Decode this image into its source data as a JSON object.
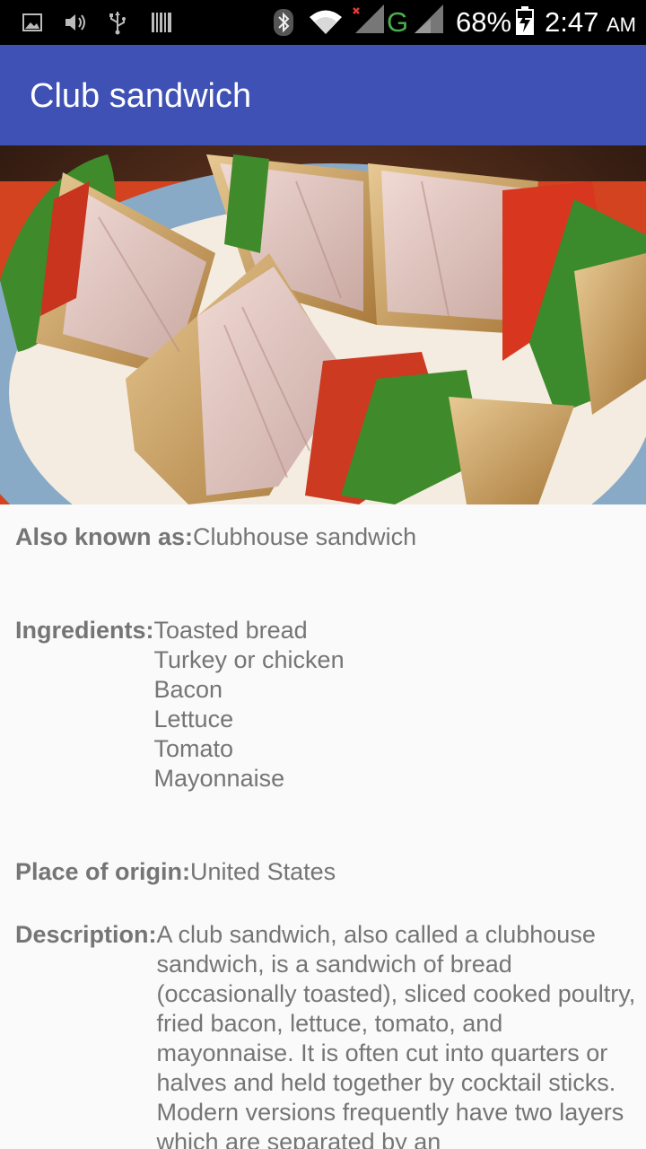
{
  "status_bar": {
    "icons": [
      "image-icon",
      "volume-icon",
      "usb-icon",
      "barcode-icon",
      "bluetooth-icon",
      "wifi-icon",
      "signal-no-sim-icon",
      "signal-icon"
    ],
    "network_type": "G",
    "battery_percent": "68%",
    "battery_level": 0.68,
    "time": "2:47",
    "ampm": "AM"
  },
  "app_bar": {
    "title": "Club sandwich"
  },
  "hero": {
    "image_subject": "club sandwich on a plate"
  },
  "details": {
    "also_known_as": {
      "label": "Also known as:",
      "value": "Clubhouse sandwich"
    },
    "ingredients": {
      "label": "Ingredients:",
      "value": "Toasted bread\nTurkey or chicken\nBacon\nLettuce\nTomato\nMayonnaise"
    },
    "place_of_origin": {
      "label": "Place of origin:",
      "value": "United States"
    },
    "description": {
      "label": "Description:",
      "value": "A club sandwich, also called a clubhouse sandwich, is a sandwich of bread (occasionally toasted), sliced cooked poultry, fried bacon, lettuce, tomato, and mayonnaise. It is often cut into quarters or halves and held together by cocktail sticks. Modern versions frequently have two layers which are separated by an"
    }
  }
}
